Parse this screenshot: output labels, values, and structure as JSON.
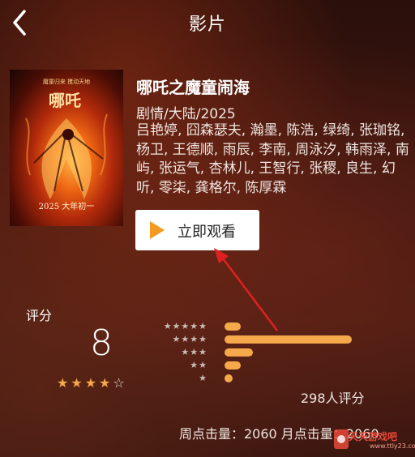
{
  "header": {
    "title": "影片"
  },
  "movie": {
    "poster": {
      "tagline": "魔童归来 搅动天地",
      "logo": "哪吒",
      "date": "2025 大年初一"
    },
    "title": "哪吒之魔童闹海",
    "genre": "剧情/大陆/2025",
    "cast": "吕艳婷, 囧森瑟夫, 瀚墨, 陈浩, 绿绮, 张珈铭, 杨卫, 王德顺, 雨辰, 李南, 周泳汐, 韩雨泽, 南屿, 张运气, 杏林儿, 王智行, 张稷, 良生, 幻听, 零柒, 龚格尔, 陈厚霖"
  },
  "watch_button": {
    "label": "立即观看",
    "icon": "play-icon"
  },
  "rating": {
    "label": "评分",
    "score": "8",
    "stars_filled": 4,
    "stars_total": 5,
    "distribution": [
      {
        "stars": "★★★★★",
        "fraction": 0.13
      },
      {
        "stars": "★★★★",
        "fraction": 1.0
      },
      {
        "stars": "★★★",
        "fraction": 0.22
      },
      {
        "stars": "★★",
        "fraction": 0.13
      },
      {
        "stars": "★",
        "fraction": 0.04
      }
    ],
    "count_text": "298人评分"
  },
  "clicks_text": "周点击量：2060  月点击量：2060",
  "watermark": {
    "text": "天天游戏吧",
    "url": "www.ttly23.com"
  },
  "colors": {
    "accent": "#f6a94a",
    "annotation_arrow": "#e02020"
  }
}
